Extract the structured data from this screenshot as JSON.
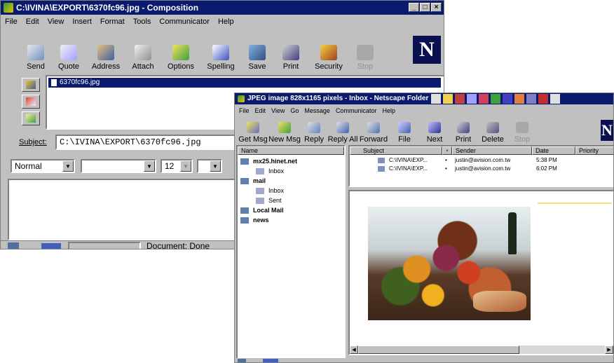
{
  "composition": {
    "title": "C:\\IVINA\\EXPORT\\6370fc96.jpg - Composition",
    "menu": [
      "File",
      "Edit",
      "View",
      "Insert",
      "Format",
      "Tools",
      "Communicator",
      "Help"
    ],
    "toolbar": [
      "Send",
      "Quote",
      "Address",
      "Attach",
      "Options",
      "Spelling",
      "Save",
      "Print",
      "Security",
      "Stop"
    ],
    "attachment": "6370fc96.jpg",
    "subject_label": "Subject:",
    "subject_value": "C:\\IVINA\\EXPORT\\6370fc96.jpg",
    "style_value": "Normal",
    "font_value": "",
    "size_value": "12",
    "status": "Document: Done",
    "logo": "N"
  },
  "inbox": {
    "title": "JPEG image 828x1165 pixels - Inbox - Netscape Folder",
    "menu": [
      "File",
      "Edit",
      "View",
      "Go",
      "Message",
      "Communicator",
      "Help"
    ],
    "toolbar": [
      "Get Msg",
      "New Msg",
      "Reply",
      "Reply All",
      "Forward",
      "File",
      "Next",
      "Print",
      "Delete",
      "Stop"
    ],
    "folder_header": "Name",
    "folders": [
      {
        "label": "mx25.hinet.net",
        "bold": true,
        "indent": 0
      },
      {
        "label": "Inbox",
        "bold": false,
        "indent": 1
      },
      {
        "label": "mail",
        "bold": true,
        "indent": 0
      },
      {
        "label": "Inbox",
        "bold": false,
        "indent": 1
      },
      {
        "label": "Sent",
        "bold": false,
        "indent": 1
      },
      {
        "label": "Local Mail",
        "bold": true,
        "indent": 0
      },
      {
        "label": "news",
        "bold": true,
        "indent": 0
      }
    ],
    "columns": [
      "Subject",
      "Sender",
      "Date",
      "Priority"
    ],
    "messages": [
      {
        "subject": "C:\\IVINA\\EXP...",
        "sender": "justin@avision.com.tw",
        "date": "5:38 PM"
      },
      {
        "subject": "C:\\IVINA\\EXP...",
        "sender": "justin@avision.com.tw",
        "date": "6:02 PM"
      }
    ],
    "logo": "N"
  },
  "colors": {
    "title_bg": "#0a1a6e",
    "chrome": "#c0c0c0",
    "logo_bg": "#0a1050"
  }
}
